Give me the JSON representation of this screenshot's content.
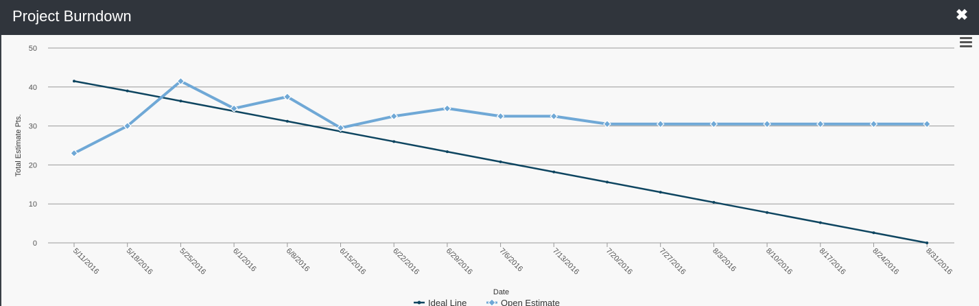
{
  "window": {
    "title": "Project Burndown",
    "close_label": "✖"
  },
  "icons": {
    "close": "close-icon",
    "menu": "hamburger-menu-icon"
  },
  "colors": {
    "ideal": "#0e4560",
    "open": "#6fa8d6",
    "grid": "#9a9a9a",
    "titlebar": "#30353c"
  },
  "chart_data": {
    "type": "line",
    "xlabel": "Date",
    "ylabel": "Total Estimate Pts.",
    "ylim": [
      0,
      50
    ],
    "yticks": [
      0,
      10,
      20,
      30,
      40,
      50
    ],
    "grid": true,
    "legend_position": "bottom-center",
    "categories": [
      "5/11/2016",
      "5/18/2016",
      "5/25/2016",
      "6/1/2016",
      "6/8/2016",
      "6/15/2016",
      "6/22/2016",
      "6/29/2016",
      "7/6/2016",
      "7/13/2016",
      "7/20/2016",
      "7/27/2016",
      "8/3/2016",
      "8/10/2016",
      "8/17/2016",
      "8/24/2016",
      "8/31/2016"
    ],
    "series": [
      {
        "name": "Ideal Line",
        "color": "#0e4560",
        "marker": "circle",
        "values": [
          41.5,
          39.0,
          36.4,
          33.8,
          31.2,
          28.6,
          26.0,
          23.4,
          20.8,
          18.2,
          15.6,
          13.0,
          10.4,
          7.8,
          5.2,
          2.6,
          0
        ]
      },
      {
        "name": "Open Estimate",
        "color": "#6fa8d6",
        "marker": "diamond",
        "values": [
          23,
          30,
          41.5,
          34.5,
          37.5,
          29.5,
          32.5,
          34.5,
          32.5,
          32.5,
          30.5,
          30.5,
          30.5,
          30.5,
          30.5,
          30.5,
          30.5
        ]
      }
    ]
  }
}
